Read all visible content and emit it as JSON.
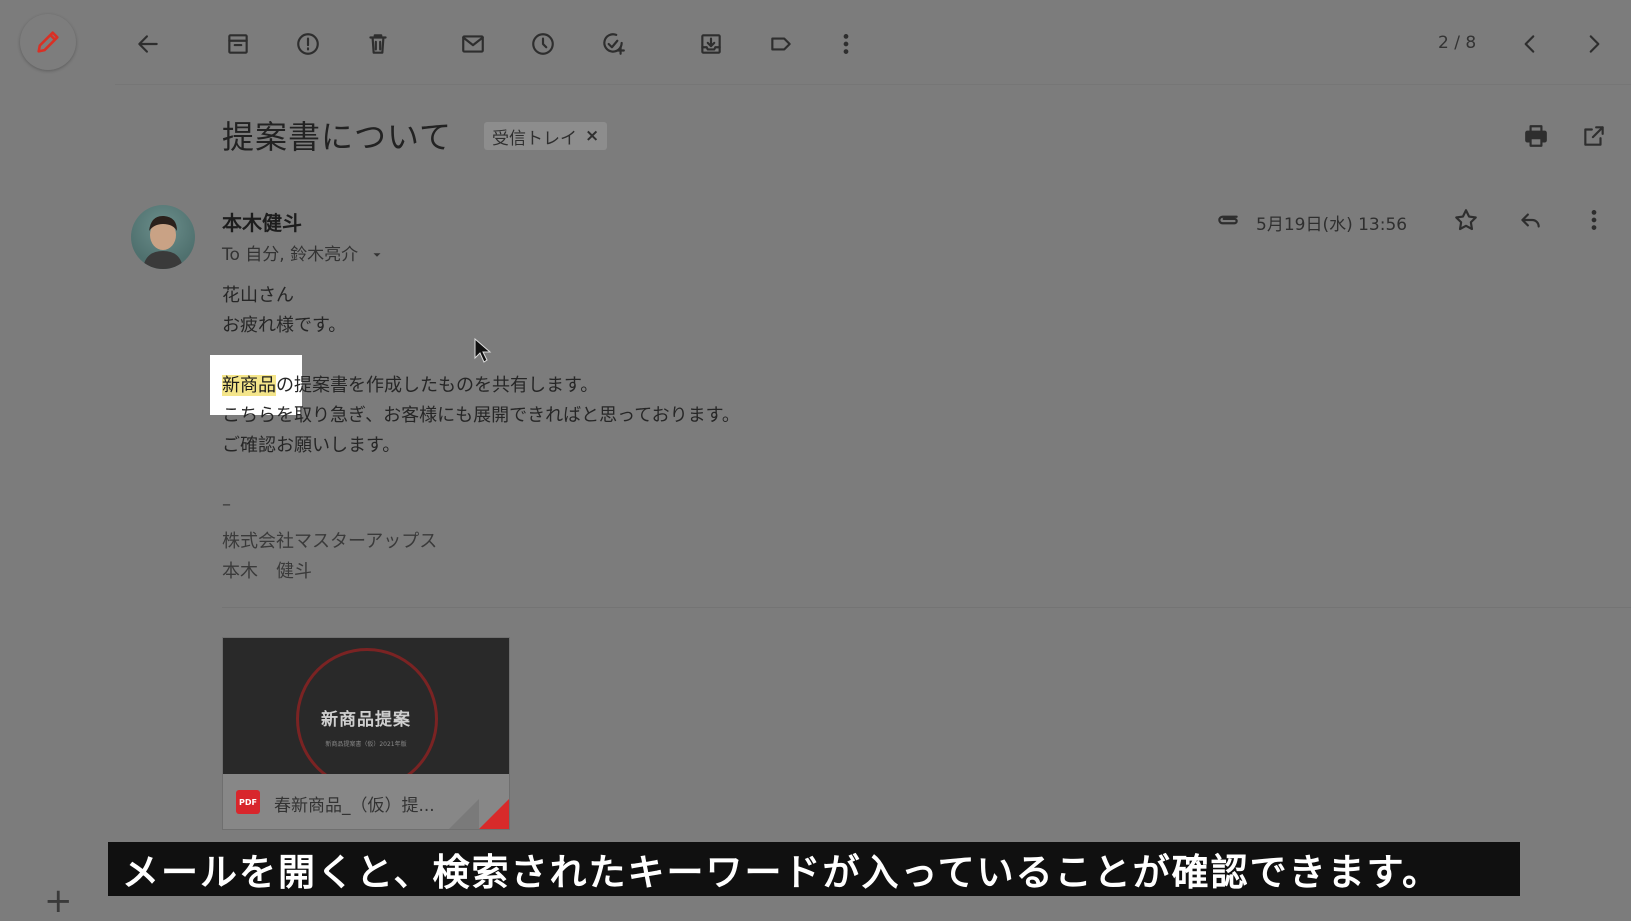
{
  "toolbar": {
    "back_icon": "arrow-left-icon",
    "actions": [
      "archive-icon",
      "report-spam-icon",
      "delete-icon",
      "mark-unread-icon",
      "snooze-icon",
      "add-task-icon",
      "move-to-icon",
      "label-icon",
      "more-vert-icon"
    ],
    "pager": "2 / 8"
  },
  "email": {
    "subject": "提案書について",
    "label_chip": "受信トレイ",
    "label_chip_close": "×",
    "sender_name": "本木健斗",
    "recipients": "To 自分, 鈴木亮介",
    "date": "5月19日(水) 13:56",
    "body": {
      "line1": "花山さん",
      "line2": "お疲れ様です。",
      "highlight": "新商品",
      "line3_rest": "の提案書を作成したものを共有します。",
      "line4": "こちらを取り急ぎ、お客様にも展開できればと思っております。",
      "line5": "ご確認お願いします。"
    },
    "signature": {
      "dash": "–",
      "company": "株式会社マスターアップス",
      "name": "本木　健斗"
    },
    "attachment": {
      "thumb_title": "新商品提案",
      "thumb_subtitle": "新商品提案書（仮）2021年版",
      "type_badge": "PDF",
      "filename": "春新商品_（仮）提..."
    }
  },
  "caption": "メールを開くと、検索されたキーワードが入っていることが確認できます。",
  "sidebar": {
    "plus_label": "+"
  },
  "colors": {
    "compose_pencil": "#d93025",
    "highlight": "#f4e58a",
    "pdf_red": "#d8262c"
  }
}
